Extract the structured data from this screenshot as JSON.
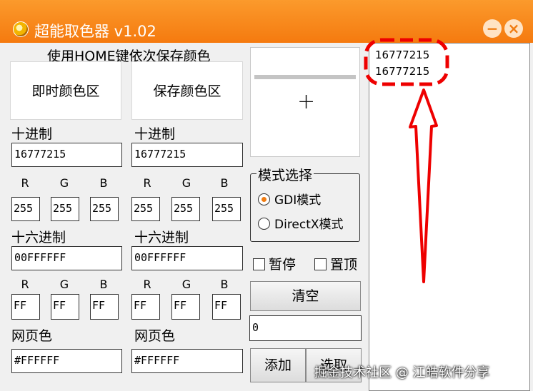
{
  "window": {
    "title": "超能取色器 v1.02",
    "minimize_glyph": "−",
    "close_glyph": "×"
  },
  "hint": "使用HOME键依次保存颜色",
  "live": {
    "box_label": "即时颜色区",
    "decimal_label": "十进制",
    "decimal_value": "16777215",
    "rgb_labels": [
      "R",
      "G",
      "B"
    ],
    "rgb_dec": [
      "255",
      "255",
      "255"
    ],
    "hex_label": "十六进制",
    "hex_value": "00FFFFFF",
    "rgb_hex": [
      "FF",
      "FF",
      "FF"
    ],
    "web_label": "网页色",
    "web_value": "#FFFFFF"
  },
  "saved": {
    "box_label": "保存颜色区",
    "decimal_label": "十进制",
    "decimal_value": "16777215",
    "rgb_labels": [
      "R",
      "G",
      "B"
    ],
    "rgb_dec": [
      "255",
      "255",
      "255"
    ],
    "hex_label": "十六进制",
    "hex_value": "00FFFFFF",
    "rgb_hex": [
      "FF",
      "FF",
      "FF"
    ],
    "web_label": "网页色",
    "web_value": "#FFFFFF"
  },
  "preview": {
    "crosshair": "+"
  },
  "mode": {
    "title": "模式选择",
    "options": [
      "GDI模式",
      "DirectX模式"
    ],
    "selected": "GDI模式"
  },
  "checks": {
    "pause": "暂停",
    "topmost": "置顶"
  },
  "buttons": {
    "clear": "清空",
    "add": "添加",
    "pick": "选取"
  },
  "counter_value": "0",
  "log": [
    "16777215",
    "16777215"
  ],
  "watermark": "掘金技术社区 @ 江皓软件分享",
  "colors": {
    "title_bar": "#f57a0f",
    "annotation": "#ee0000",
    "window_bg": "#f0f0f0"
  },
  "icons": [
    "app-logo-icon",
    "minimize-icon",
    "close-icon",
    "crosshair-icon"
  ]
}
